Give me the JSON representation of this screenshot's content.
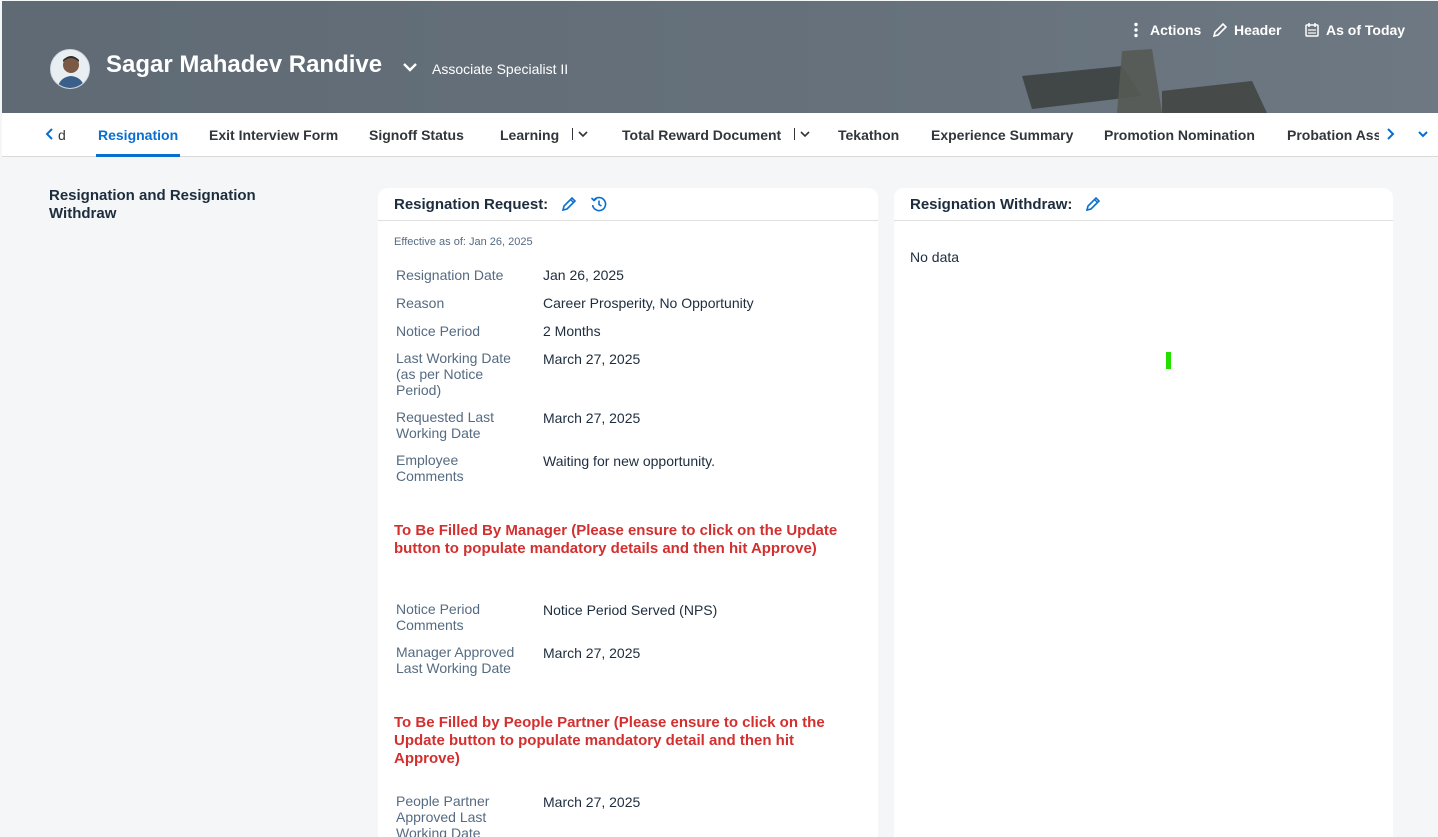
{
  "header": {
    "employee_name": "Sagar Mahadev Randive",
    "employee_title": "Associate Specialist II",
    "actions": [
      {
        "label": "Actions",
        "icon": "more-vertical-icon"
      },
      {
        "label": "Header",
        "icon": "pencil-icon"
      },
      {
        "label": "As of Today",
        "icon": "calendar-icon"
      }
    ]
  },
  "tabs": {
    "partial_left": "d",
    "items": [
      {
        "label": "Resignation",
        "active": true
      },
      {
        "label": "Exit Interview Form"
      },
      {
        "label": "Signoff Status"
      },
      {
        "label": "Learning",
        "has_menu": true
      },
      {
        "label": "Total Reward Document",
        "has_menu": true
      },
      {
        "label": "Tekathon"
      },
      {
        "label": "Experience Summary"
      },
      {
        "label": "Promotion Nomination"
      },
      {
        "label": "Probation Ass"
      }
    ]
  },
  "section": {
    "title": "Resignation and Resignation Withdraw"
  },
  "resignation_request": {
    "title": "Resignation Request:",
    "effective": "Effective as of: Jan 26, 2025",
    "fields": [
      {
        "label": "Resignation Date",
        "value": "Jan 26, 2025"
      },
      {
        "label": "Reason",
        "value": "Career Prosperity, No Opportunity"
      },
      {
        "label": "Notice Period",
        "value": "2 Months"
      },
      {
        "label": "Last Working Date (as per Notice Period)",
        "value": "March 27, 2025"
      },
      {
        "label": "Requested Last Working Date",
        "value": "March 27, 2025"
      },
      {
        "label": "Employee Comments",
        "value": "Waiting for new opportunity."
      }
    ],
    "manager_note": "To Be Filled By Manager (Please ensure to click on the Update button to populate mandatory details and then hit Approve)",
    "manager_fields": [
      {
        "label": "Notice Period Comments",
        "value": "Notice Period Served (NPS)"
      },
      {
        "label": "Manager Approved Last Working Date",
        "value": "March 27, 2025"
      }
    ],
    "partner_note": "To Be Filled by People Partner (Please ensure to click on the Update button to populate mandatory detail and then hit Approve)",
    "partner_fields": [
      {
        "label": "People Partner Approved Last Working Date",
        "value": "March 27, 2025"
      }
    ]
  },
  "resignation_withdraw": {
    "title": "Resignation Withdraw:",
    "empty_text": "No data"
  },
  "colors": {
    "accent": "#0a6ed1",
    "note_red": "#d32f2f",
    "header_bg": "#66717b"
  }
}
